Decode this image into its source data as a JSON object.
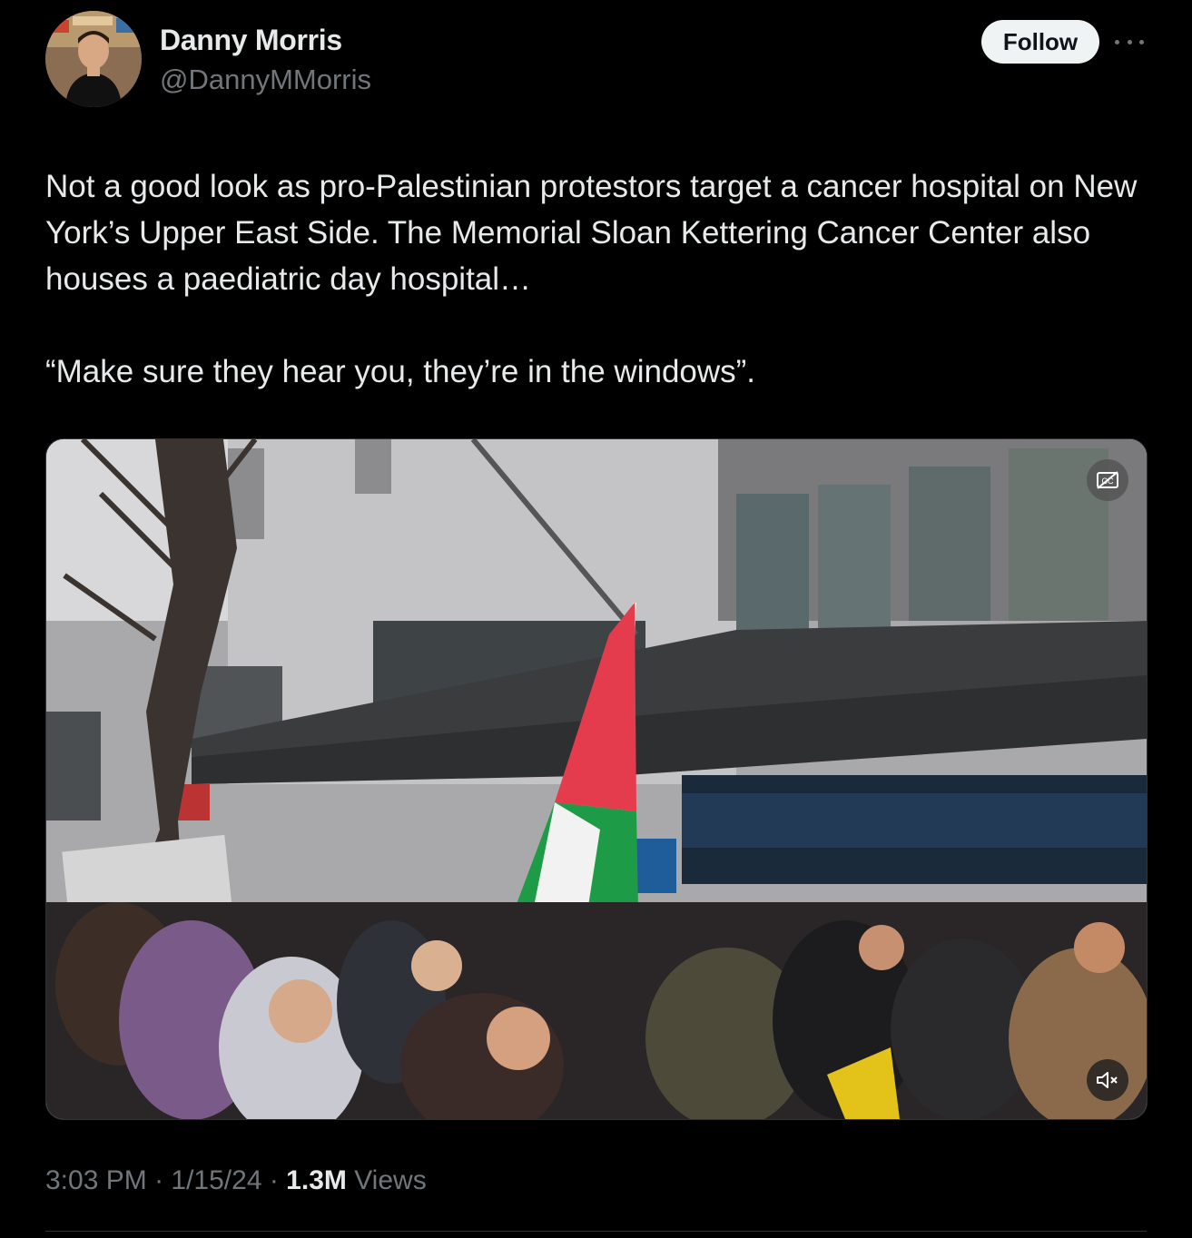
{
  "author": {
    "name": "Danny Morris",
    "handle": "@DannyMMorris",
    "avatar_icon": "profile-photo"
  },
  "actions": {
    "follow_label": "Follow",
    "more_icon": "more-horizontal-icon"
  },
  "tweet": {
    "paragraphs": [
      "Not a good look as pro-Palestinian protestors target a cancer hospital on New York’s Upper East Side. The Memorial Sloan Kettering Cancer Center also houses a paediatric day hospital…",
      "“Make sure they hear you, they’re in the windows”."
    ]
  },
  "media": {
    "type": "video",
    "cc_icon": "closed-captions-off-icon",
    "mute_icon": "volume-muted-icon"
  },
  "meta": {
    "time": "3:03 PM",
    "separator": " · ",
    "date": "1/15/24",
    "views_count": "1.3M",
    "views_label": "Views"
  },
  "colors": {
    "background": "#000000",
    "text_primary": "#e7e9ea",
    "text_secondary": "#71767b",
    "follow_bg": "#eff3f4",
    "divider": "#2f3336"
  }
}
